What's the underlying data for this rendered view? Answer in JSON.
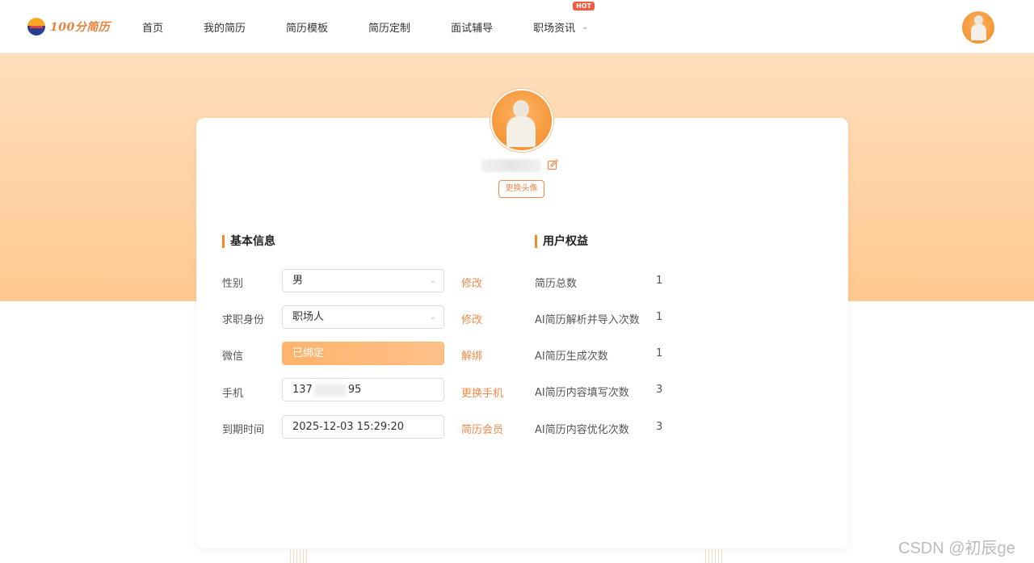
{
  "header": {
    "logo_text": "100分简历",
    "nav": [
      {
        "label": "首页"
      },
      {
        "label": "我的简历"
      },
      {
        "label": "简历模板"
      },
      {
        "label": "简历定制"
      },
      {
        "label": "面试辅导"
      },
      {
        "label": "职场资讯",
        "badge": "HOT",
        "has_dropdown": true
      }
    ]
  },
  "profile": {
    "change_avatar_label": "更换头像"
  },
  "basic_info": {
    "title": "基本信息",
    "rows": [
      {
        "label": "性别",
        "value": "男",
        "type": "select",
        "action": "修改"
      },
      {
        "label": "求职身份",
        "value": "职场人",
        "type": "select",
        "action": "修改"
      },
      {
        "label": "微信",
        "value": "已绑定",
        "type": "status",
        "action": "解绑"
      },
      {
        "label": "手机",
        "value_prefix": "137",
        "value_suffix": "95",
        "type": "text",
        "action": "更换手机"
      },
      {
        "label": "到期时间",
        "value": "2025-12-03 15:29:20",
        "type": "text",
        "action": "简历会员"
      }
    ]
  },
  "benefits": {
    "title": "用户权益",
    "rows": [
      {
        "label": "简历总数",
        "value": "1"
      },
      {
        "label": "AI简历解析并导入次数",
        "value": "1"
      },
      {
        "label": "AI简历生成次数",
        "value": "1"
      },
      {
        "label": "AI简历内容填写次数",
        "value": "3"
      },
      {
        "label": "AI简历内容优化次数",
        "value": "3"
      }
    ]
  },
  "watermark": "CSDN @初辰ge",
  "colors": {
    "accent": "#f08a24",
    "action": "#f08a4b",
    "banner_top": "#ffdfbd",
    "banner_bottom": "#ffc98f"
  }
}
